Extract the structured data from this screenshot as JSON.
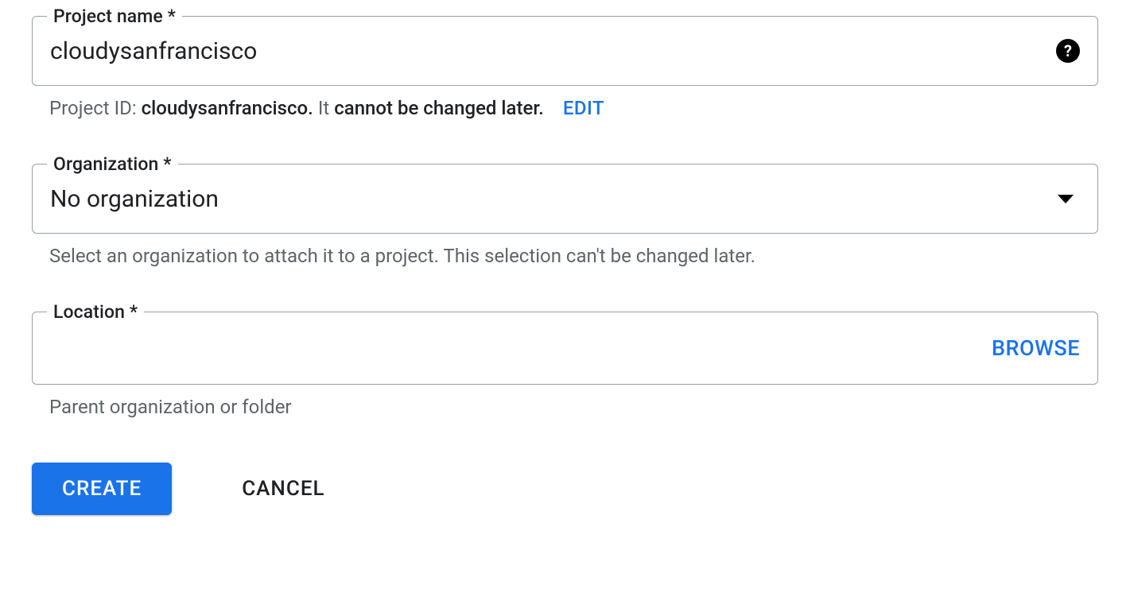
{
  "projectName": {
    "label": "Project name *",
    "value": "cloudysanfrancisco",
    "helper": {
      "prefix": "Project ID:",
      "id": "cloudysanfrancisco.",
      "mid": "It",
      "cannotPhrase": "cannot be changed later.",
      "editLabel": "EDIT"
    }
  },
  "organization": {
    "label": "Organization *",
    "value": "No organization",
    "helper": "Select an organization to attach it to a project. This selection can't be changed later."
  },
  "location": {
    "label": "Location *",
    "browseLabel": "BROWSE",
    "helper": "Parent organization or folder"
  },
  "actions": {
    "create": "CREATE",
    "cancel": "CANCEL"
  }
}
